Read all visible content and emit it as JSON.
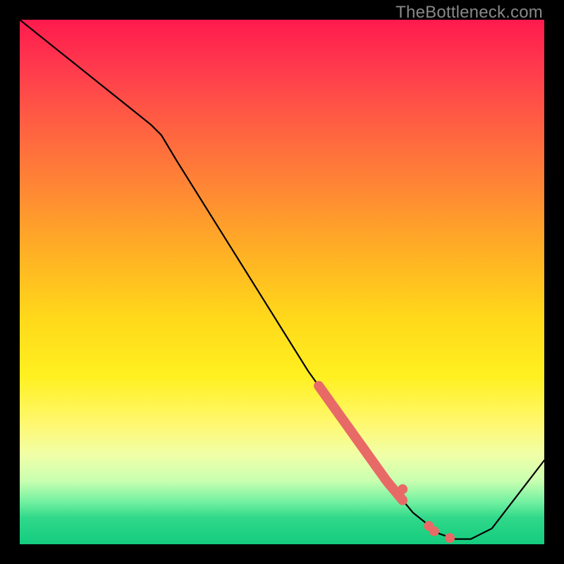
{
  "attribution": "TheBottleneck.com",
  "chart_data": {
    "type": "line",
    "title": "",
    "xlabel": "",
    "ylabel": "",
    "xlim": [
      0,
      100
    ],
    "ylim": [
      0,
      100
    ],
    "background": "vertical-gradient-red-to-green",
    "series": [
      {
        "name": "bottleneck-curve",
        "x": [
          0,
          5,
          10,
          15,
          20,
          25,
          27,
          30,
          35,
          40,
          45,
          50,
          55,
          60,
          65,
          70,
          75,
          80,
          83,
          86,
          90,
          100
        ],
        "values": [
          100,
          96,
          92,
          88,
          84,
          80,
          78,
          73,
          65,
          57,
          49,
          41,
          33,
          26,
          19,
          12,
          6,
          2,
          1,
          1,
          3,
          16
        ]
      }
    ],
    "highlight_segment": {
      "series": "bottleneck-curve",
      "x_from": 57,
      "x_to": 73,
      "color": "#e86a66"
    },
    "markers": [
      {
        "x": 73,
        "y": 10.5,
        "color": "#e86a66"
      },
      {
        "x": 78,
        "y": 3.5,
        "color": "#e86a66"
      },
      {
        "x": 79,
        "y": 2.5,
        "color": "#e86a66"
      },
      {
        "x": 82,
        "y": 1.2,
        "color": "#e86a66"
      }
    ]
  }
}
